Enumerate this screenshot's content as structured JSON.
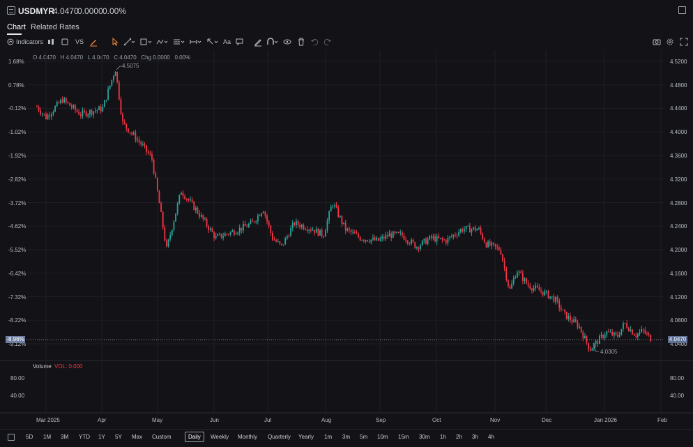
{
  "header": {
    "symbol": "USDMYR",
    "price": "4.0470",
    "change": "0.0000",
    "change_pct": "0.00%"
  },
  "tabs": [
    {
      "label": "Chart",
      "active": true
    },
    {
      "label": "Related Rates",
      "active": false
    }
  ],
  "toolbar": {
    "indicators_label": "Indicators",
    "compare_label": "VS",
    "text_label": "Aa"
  },
  "ohlc": {
    "o": "O 4.0470",
    "h": "H 4.0470",
    "l": "L 4.0470",
    "c": "C 4.0470",
    "chg": "Chg 0.0000",
    "chg_pct": "0.00%"
  },
  "left_axis": [
    "1.68%",
    "0.78%",
    "-0.12%",
    "-1.02%",
    "-1.92%",
    "-2.82%",
    "-3.72%",
    "-4.62%",
    "-5.52%",
    "-6.42%",
    "-7.32%",
    "-8.22%",
    "-9.12%"
  ],
  "right_axis": [
    "4.5200",
    "4.4800",
    "4.4400",
    "4.4000",
    "4.3600",
    "4.3200",
    "4.2800",
    "4.2400",
    "4.2000",
    "4.1600",
    "4.1200",
    "4.0800",
    "4.0400"
  ],
  "current": {
    "pct": "-8.96%",
    "price": "4.0470"
  },
  "annotations": {
    "high": "4.5075",
    "low": "4.0305"
  },
  "volume": {
    "label": "Volume",
    "value": "VOL: 0.000",
    "axis": [
      "80.00",
      "40.00"
    ]
  },
  "x_axis": [
    "Mar 2025",
    "Apr",
    "May",
    "Jun",
    "Jul",
    "Aug",
    "Sep",
    "Oct",
    "Nov",
    "Dec",
    "Jan 2026",
    "Feb"
  ],
  "ranges": [
    "5D",
    "1M",
    "3M",
    "YTD",
    "1Y",
    "5Y",
    "Max",
    "Custom"
  ],
  "intervals": [
    "Daily",
    "Weekly",
    "Monthly",
    "Quarterly",
    "Yearly",
    "1m",
    "3m",
    "5m",
    "10m",
    "15m",
    "30m",
    "1h",
    "2h",
    "3h",
    "4h"
  ],
  "active_interval": "Daily",
  "colors": {
    "up": "#26a69a",
    "down": "#f23645",
    "background": "#131317",
    "accent": "#f0883e"
  },
  "chart_data": {
    "type": "candlestick",
    "title": "USDMYR",
    "y_range_price": [
      4.02,
      4.53
    ],
    "x": [
      "Mar 2025",
      "Apr",
      "May",
      "Jun",
      "Jul",
      "Aug",
      "Sep",
      "Oct",
      "Nov",
      "Dec",
      "Jan 2026",
      "Feb"
    ],
    "keypoints": [
      {
        "date": "2025-02-24",
        "price": 4.443
      },
      {
        "date": "2025-03-01",
        "price": 4.425
      },
      {
        "date": "2025-03-10",
        "price": 4.455
      },
      {
        "date": "2025-03-20",
        "price": 4.43
      },
      {
        "date": "2025-04-01",
        "price": 4.44
      },
      {
        "date": "2025-04-08",
        "price": 4.5075
      },
      {
        "date": "2025-04-12",
        "price": 4.415
      },
      {
        "date": "2025-04-22",
        "price": 4.38
      },
      {
        "date": "2025-04-28",
        "price": 4.355
      },
      {
        "date": "2025-05-02",
        "price": 4.28
      },
      {
        "date": "2025-05-06",
        "price": 4.2
      },
      {
        "date": "2025-05-14",
        "price": 4.3
      },
      {
        "date": "2025-05-23",
        "price": 4.265
      },
      {
        "date": "2025-06-02",
        "price": 4.22
      },
      {
        "date": "2025-06-15",
        "price": 4.235
      },
      {
        "date": "2025-06-22",
        "price": 4.245
      },
      {
        "date": "2025-06-28",
        "price": 4.27
      },
      {
        "date": "2025-07-03",
        "price": 4.22
      },
      {
        "date": "2025-07-08",
        "price": 4.205
      },
      {
        "date": "2025-07-15",
        "price": 4.245
      },
      {
        "date": "2025-07-25",
        "price": 4.235
      },
      {
        "date": "2025-07-31",
        "price": 4.225
      },
      {
        "date": "2025-08-05",
        "price": 4.28
      },
      {
        "date": "2025-08-12",
        "price": 4.235
      },
      {
        "date": "2025-08-20",
        "price": 4.22
      },
      {
        "date": "2025-08-30",
        "price": 4.215
      },
      {
        "date": "2025-09-05",
        "price": 4.225
      },
      {
        "date": "2025-09-12",
        "price": 4.225
      },
      {
        "date": "2025-09-20",
        "price": 4.205
      },
      {
        "date": "2025-09-28",
        "price": 4.22
      },
      {
        "date": "2025-10-06",
        "price": 4.215
      },
      {
        "date": "2025-10-15",
        "price": 4.235
      },
      {
        "date": "2025-10-24",
        "price": 4.235
      },
      {
        "date": "2025-10-28",
        "price": 4.21
      },
      {
        "date": "2025-11-05",
        "price": 4.2
      },
      {
        "date": "2025-11-10",
        "price": 4.13
      },
      {
        "date": "2025-11-14",
        "price": 4.165
      },
      {
        "date": "2025-11-20",
        "price": 4.14
      },
      {
        "date": "2025-11-30",
        "price": 4.125
      },
      {
        "date": "2025-12-05",
        "price": 4.115
      },
      {
        "date": "2025-12-10",
        "price": 4.09
      },
      {
        "date": "2025-12-18",
        "price": 4.07
      },
      {
        "date": "2025-12-24",
        "price": 4.0305
      },
      {
        "date": "2026-01-02",
        "price": 4.06
      },
      {
        "date": "2026-01-08",
        "price": 4.052
      },
      {
        "date": "2026-01-12",
        "price": 4.075
      },
      {
        "date": "2026-01-18",
        "price": 4.055
      },
      {
        "date": "2026-01-22",
        "price": 4.062
      },
      {
        "date": "2026-01-27",
        "price": 4.047
      }
    ]
  }
}
